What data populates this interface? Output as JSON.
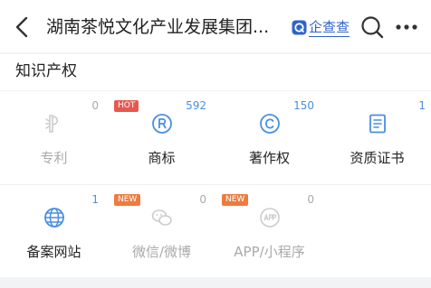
{
  "nav": {
    "back_icon": "chevron-left-icon",
    "title": "湖南茶悦文化产业发展集团...",
    "brand_label": "企查查",
    "brand_color": "#2f63c7",
    "search_icon": "search-icon",
    "more_icon": "more-icon"
  },
  "section": {
    "title": "知识产权"
  },
  "items": [
    {
      "label": "专利",
      "count": "0",
      "badge": "",
      "icon": "patent-icon",
      "disabled": true
    },
    {
      "label": "商标",
      "count": "592",
      "badge": "HOT",
      "icon": "trademark-icon",
      "disabled": false
    },
    {
      "label": "著作权",
      "count": "150",
      "badge": "",
      "icon": "copyright-icon",
      "disabled": false
    },
    {
      "label": "资质证书",
      "count": "1",
      "badge": "",
      "icon": "certificate-icon",
      "disabled": false
    },
    {
      "label": "备案网站",
      "count": "1",
      "badge": "",
      "icon": "globe-icon",
      "disabled": false
    },
    {
      "label": "微信/微博",
      "count": "0",
      "badge": "NEW",
      "icon": "wechat-weibo-icon",
      "disabled": true
    },
    {
      "label": "APP/小程序",
      "count": "0",
      "badge": "NEW",
      "icon": "app-icon",
      "disabled": true
    }
  ],
  "colors": {
    "accent": "#4a8fe0",
    "disabled": "#cccccc",
    "hot_badge": "#e6584f",
    "new_badge": "#ee7b3f"
  }
}
